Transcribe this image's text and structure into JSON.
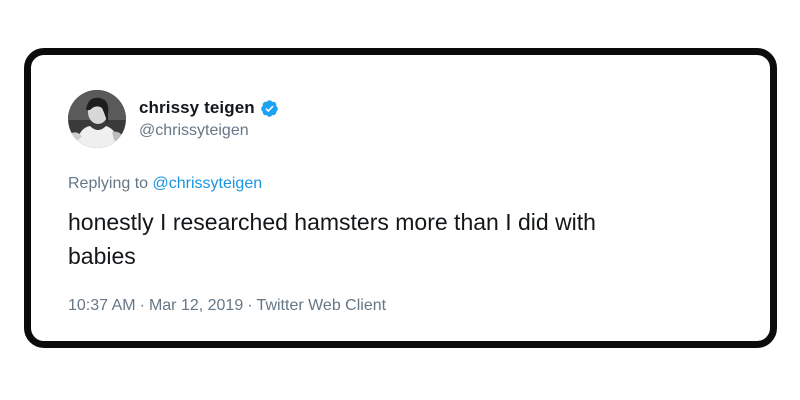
{
  "tweet": {
    "display_name": "chrissy teigen",
    "handle": "@chrissyteigen",
    "verified_icon": "verified-badge-icon",
    "replying_to_prefix": "Replying to ",
    "replying_to_handle": "@chrissyteigen",
    "text_line1": "honestly I researched hamsters more than I did with",
    "text_line2": "babies",
    "time": "10:37 AM",
    "separator": "·",
    "date": "Mar 12, 2019",
    "client": "Twitter Web Client"
  },
  "colors": {
    "card_border": "#0b0b0b",
    "name": "#14171a",
    "muted": "#657786",
    "link": "#1b95e0",
    "verified": "#1da1f2"
  }
}
